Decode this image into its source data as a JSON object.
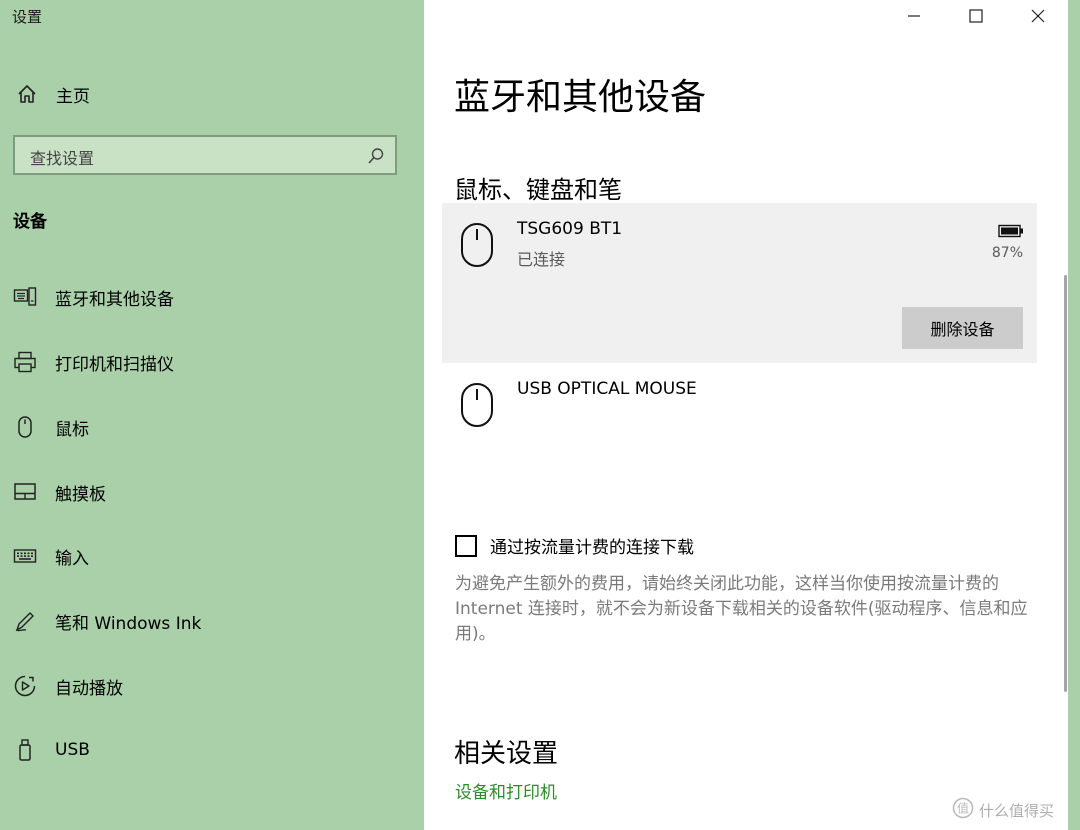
{
  "window": {
    "title": "设置",
    "controls": {
      "minimize_icon": "minimize-icon",
      "maximize_icon": "maximize-icon",
      "close_icon": "close-icon"
    }
  },
  "sidebar": {
    "home": {
      "icon": "home-icon",
      "label": "主页"
    },
    "search": {
      "placeholder": "查找设置",
      "icon": "search-icon"
    },
    "section_title": "设备",
    "items": [
      {
        "icon": "bluetooth-devices-icon",
        "label": "蓝牙和其他设备"
      },
      {
        "icon": "printer-icon",
        "label": "打印机和扫描仪"
      },
      {
        "icon": "mouse-icon",
        "label": "鼠标"
      },
      {
        "icon": "touchpad-icon",
        "label": "触摸板"
      },
      {
        "icon": "keyboard-icon",
        "label": "输入"
      },
      {
        "icon": "pen-icon",
        "label": "笔和 Windows Ink"
      },
      {
        "icon": "autoplay-icon",
        "label": "自动播放"
      },
      {
        "icon": "usb-icon",
        "label": "USB"
      }
    ],
    "background_color": "#a9d0a8"
  },
  "main": {
    "title": "蓝牙和其他设备",
    "group_title": "鼠标、键盘和笔",
    "devices": [
      {
        "icon": "mouse-icon",
        "name": "TSG609 BT1",
        "status": "已连接",
        "battery_icon": "battery-icon",
        "battery": "87%",
        "remove_label": "删除设备",
        "selected": true
      },
      {
        "icon": "mouse-icon",
        "name": "USB OPTICAL MOUSE"
      }
    ],
    "metered": {
      "label": "通过按流量计费的连接下载",
      "checked": false,
      "description": "为避免产生额外的费用，请始终关闭此功能，这样当你使用按流量计费的 Internet 连接时，就不会为新设备下载相关的设备软件(驱动程序、信息和应用)。"
    },
    "related": {
      "title": "相关设置",
      "link": "设备和打印机"
    },
    "link_color": "#2e8b2e"
  },
  "watermark": {
    "icon": "watermark-logo-icon",
    "text": "什么值得买"
  }
}
